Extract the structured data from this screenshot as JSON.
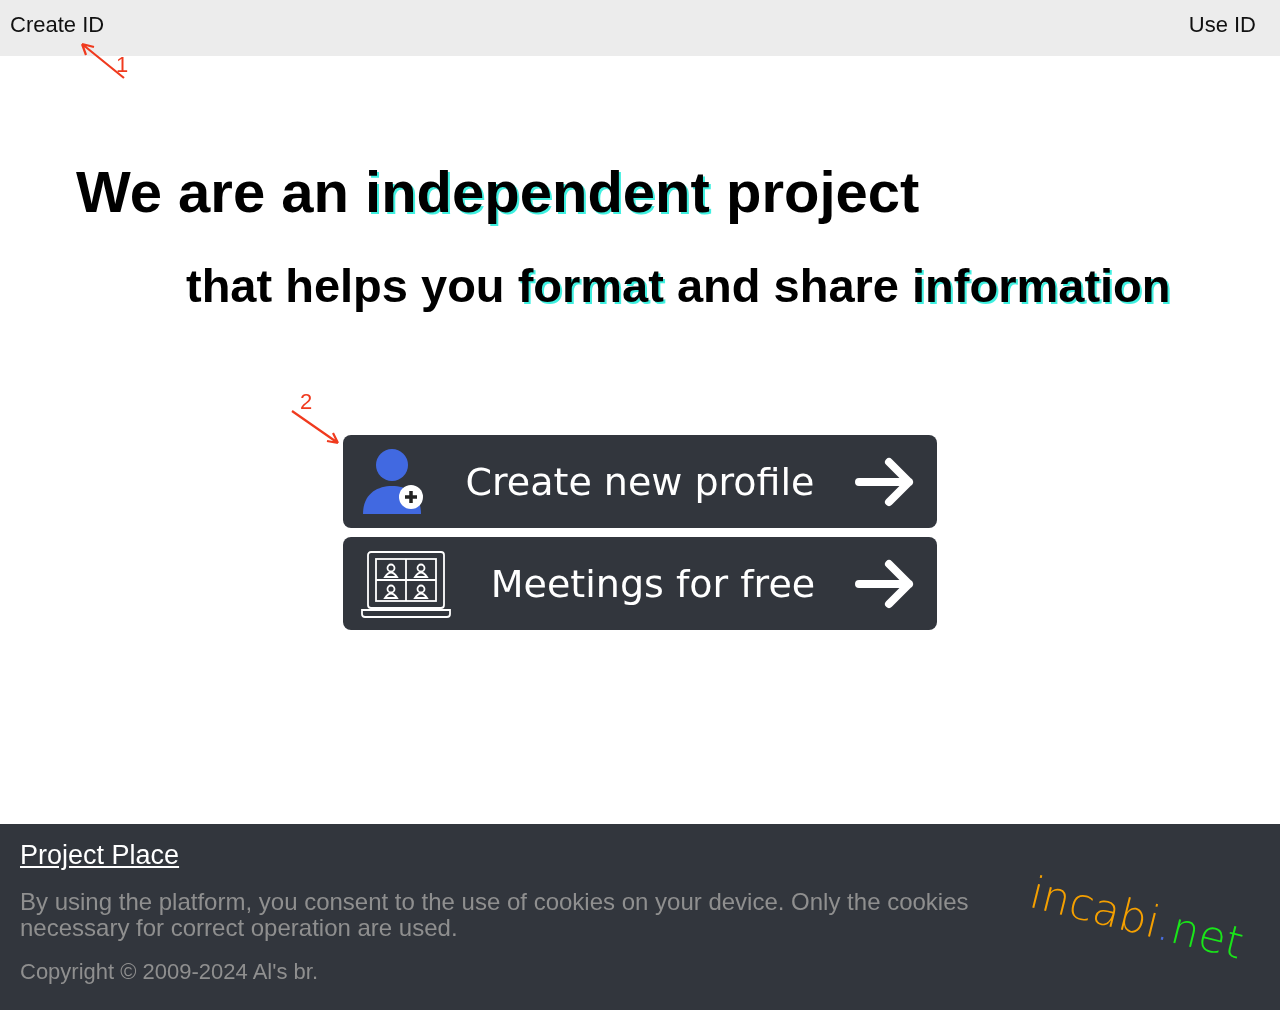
{
  "header": {
    "left_link": "Create ID",
    "right_link": "Use ID"
  },
  "headline": {
    "line_1": [
      {
        "text": "We are an ",
        "highlight": false
      },
      {
        "text": "independent",
        "highlight": true
      },
      {
        "text": " project",
        "highlight": false
      }
    ],
    "line_2": [
      {
        "text": "that helps you ",
        "highlight": false
      },
      {
        "text": "format",
        "highlight": true
      },
      {
        "text": " and share ",
        "highlight": false
      },
      {
        "text": "information",
        "highlight": true
      }
    ]
  },
  "actions": [
    {
      "kind": "profile",
      "label": "Create new profile"
    },
    {
      "kind": "meetings",
      "label": "Meetings for free"
    }
  ],
  "annotations": [
    {
      "label": "1"
    },
    {
      "label": "2"
    }
  ],
  "footer": {
    "title": "Project Place",
    "notice": "By using the platform, you consent to the use of cookies on your device. Only the cookies necessary for correct operation are used.",
    "copyright": "Copyright © 2009-2024 Al's br.",
    "logo": [
      {
        "text": "incabi",
        "color": "#f5a000"
      },
      {
        "text": ".",
        "color": "#4a6ee0"
      },
      {
        "text": "net",
        "color": "#19e619"
      }
    ]
  }
}
